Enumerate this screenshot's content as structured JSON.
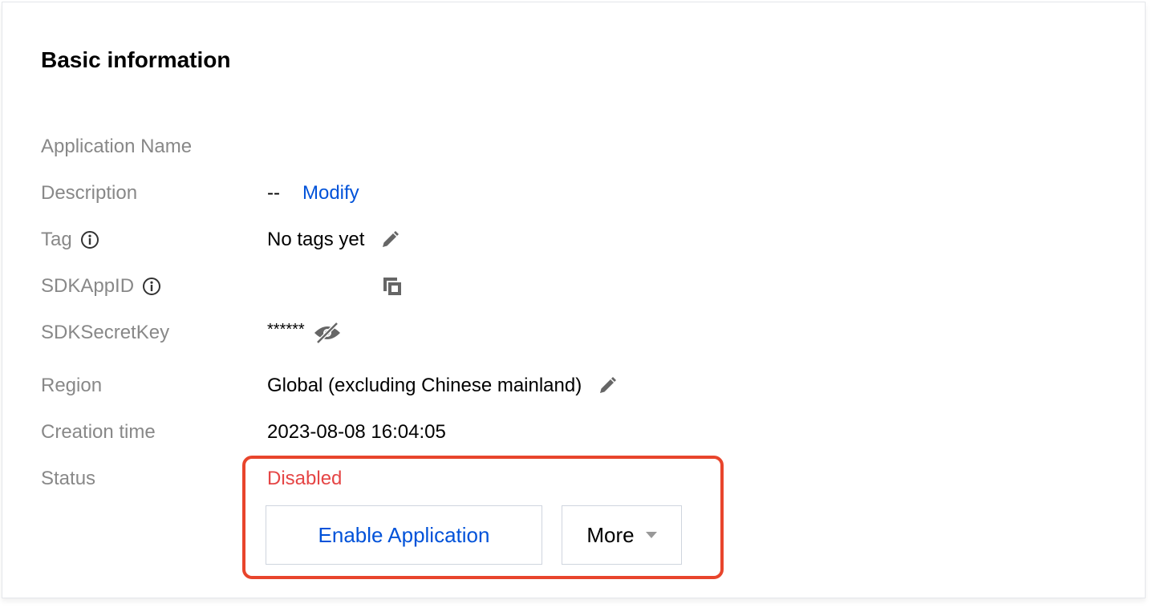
{
  "section": {
    "title": "Basic information"
  },
  "fields": {
    "app_name": {
      "label": "Application Name",
      "value": ""
    },
    "description": {
      "label": "Description",
      "value": "--",
      "action": "Modify"
    },
    "tag": {
      "label": "Tag",
      "value": "No tags yet"
    },
    "sdkappid": {
      "label": "SDKAppID",
      "value": ""
    },
    "secret": {
      "label": "SDKSecretKey",
      "value": "******"
    },
    "region": {
      "label": "Region",
      "value": "Global (excluding Chinese mainland)"
    },
    "created": {
      "label": "Creation time",
      "value": "2023-08-08 16:04:05"
    },
    "status": {
      "label": "Status",
      "value": "Disabled"
    }
  },
  "actions": {
    "enable": "Enable Application",
    "more": "More"
  },
  "colors": {
    "link": "#0052d9",
    "status_disabled": "#e54545",
    "highlight": "#e8452c",
    "label": "#888888"
  },
  "icons": {
    "info": "info-circle-icon",
    "edit": "pencil-icon",
    "copy": "copy-icon",
    "visibility": "eye-off-icon",
    "dropdown": "caret-down-icon"
  }
}
